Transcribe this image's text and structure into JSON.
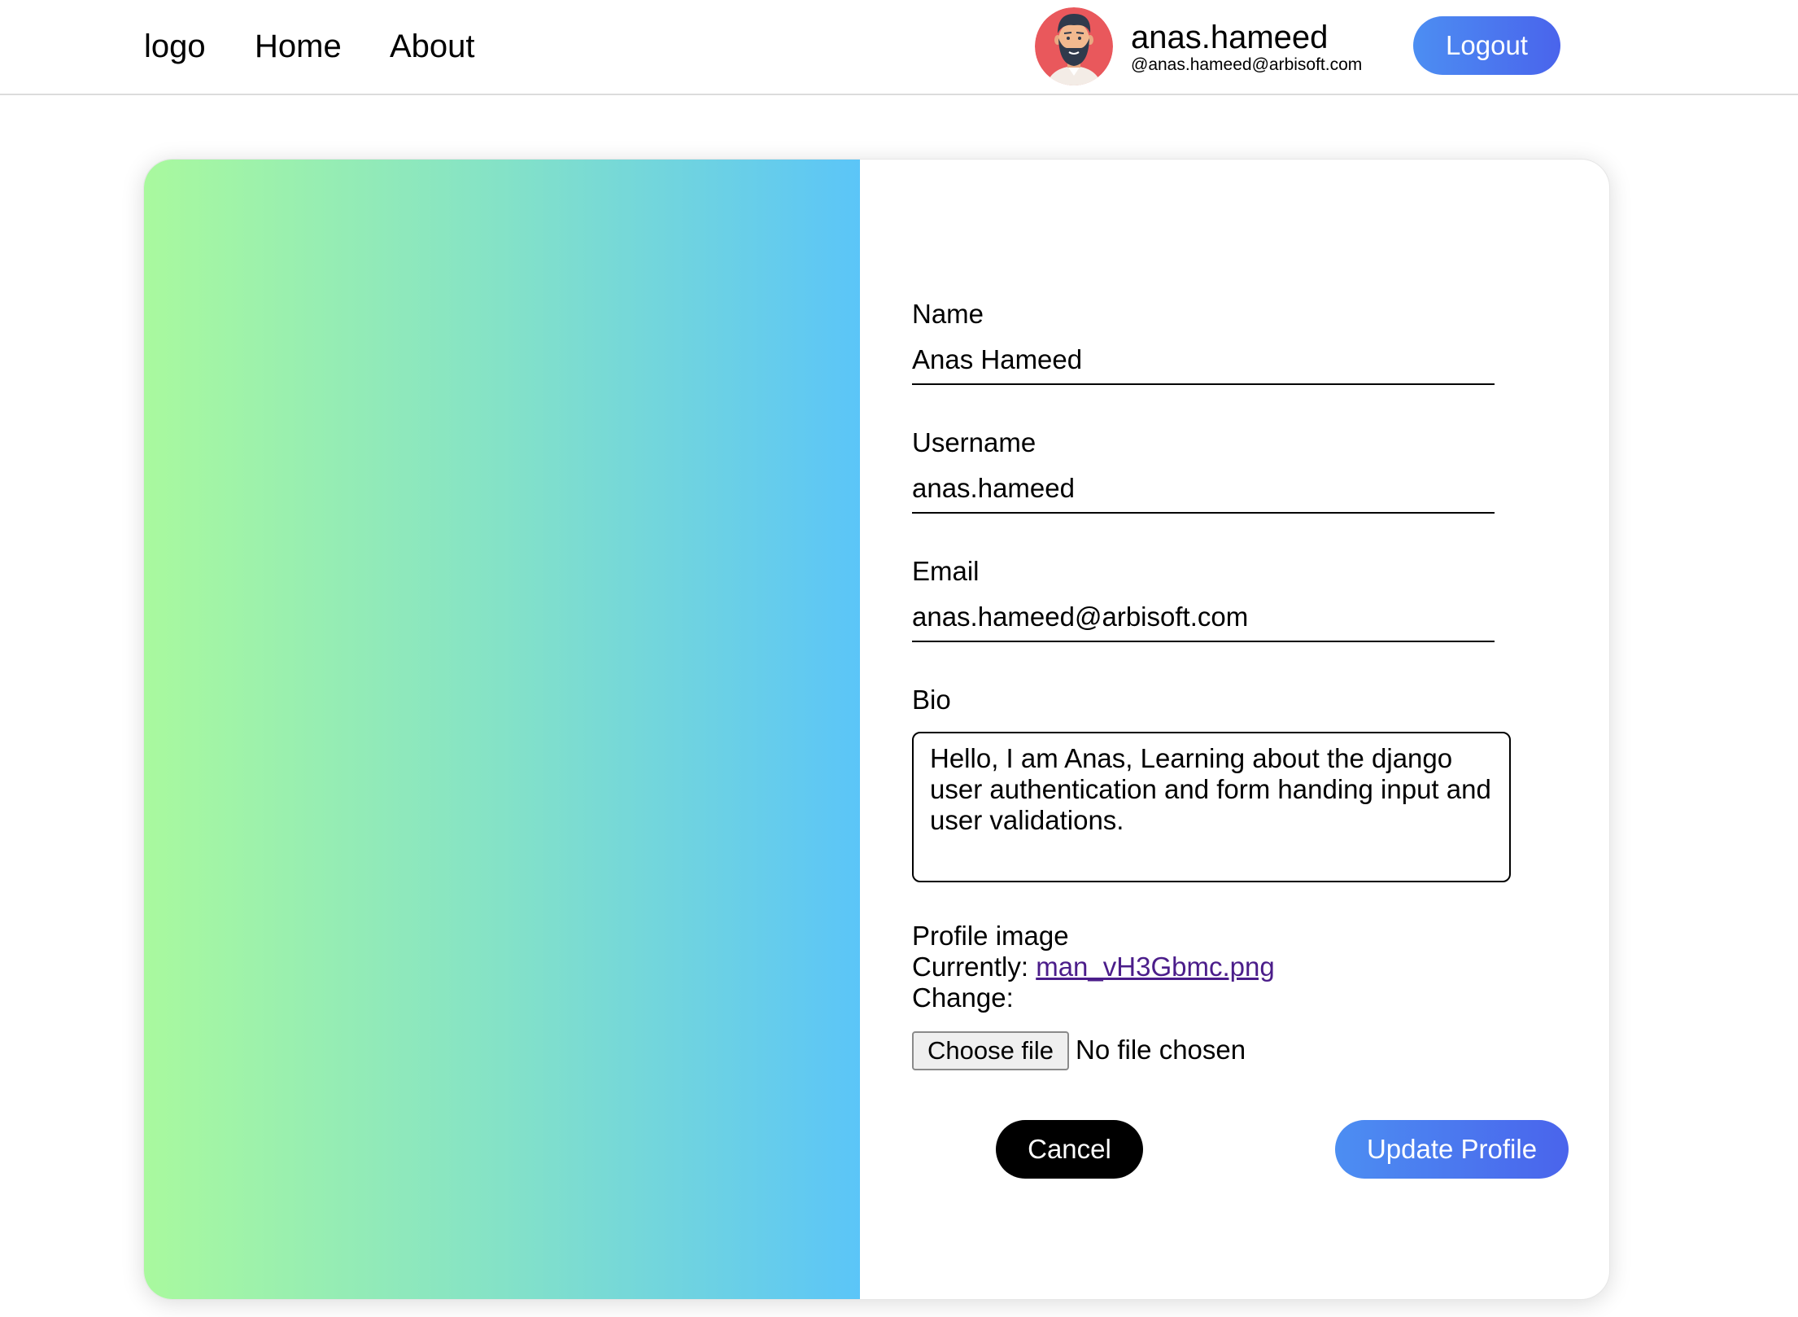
{
  "nav": {
    "logo": "logo",
    "home": "Home",
    "about": "About"
  },
  "user": {
    "username": "anas.hameed",
    "email": "@anas.hameed@arbisoft.com",
    "avatar_icon": "bearded-man-avatar",
    "logout_label": "Logout"
  },
  "form": {
    "name_label": "Name",
    "name_value": "Anas Hameed",
    "username_label": "Username",
    "username_value": "anas.hameed",
    "email_label": "Email",
    "email_value": "anas.hameed@arbisoft.com",
    "bio_label": "Bio",
    "bio_value": "Hello, I am Anas, Learning about the django user authentication and form handing input and user validations.",
    "profile_image_label": "Profile image",
    "currently_label": "Currently:",
    "current_file": "man_vH3Gbmc.png",
    "change_label": "Change:",
    "choose_file_label": "Choose file",
    "no_file_text": "No file chosen",
    "cancel_label": "Cancel",
    "update_label": "Update Profile"
  },
  "colors": {
    "accent": "#4a6cec",
    "gradient_start": "#a9f99e",
    "gradient_end": "#5bc5f8",
    "link": "#4b1d8a"
  }
}
